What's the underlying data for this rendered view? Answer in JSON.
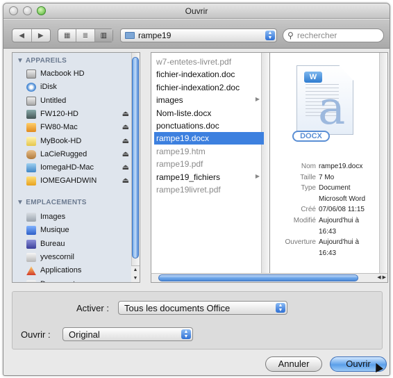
{
  "window": {
    "title": "Ouvrir"
  },
  "toolbar": {
    "back_label": "◀",
    "forward_label": "▶",
    "view_icon_label": "▦",
    "view_list_label": "≣",
    "view_column_label": "▥",
    "path": "rampe19",
    "search_placeholder": "rechercher"
  },
  "sidebar": {
    "section_devices": "▼ APPAREILS",
    "devices": [
      {
        "label": "Macbook HD",
        "icon": "hard-drive-icon",
        "eject": false
      },
      {
        "label": "iDisk",
        "icon": "idisk-icon",
        "eject": false
      },
      {
        "label": "Untitled",
        "icon": "hard-drive-icon",
        "eject": false
      },
      {
        "label": "FW120-HD",
        "icon": "external-drive-icon",
        "eject": true
      },
      {
        "label": "FW80-Mac",
        "icon": "external-drive-icon",
        "eject": true
      },
      {
        "label": "MyBook-HD",
        "icon": "external-drive-icon",
        "eject": true
      },
      {
        "label": "LaCieRugged",
        "icon": "external-drive-icon",
        "eject": true
      },
      {
        "label": "IomegaHD-Mac",
        "icon": "external-drive-icon",
        "eject": true
      },
      {
        "label": "IOMEGAHDWIN",
        "icon": "external-drive-icon",
        "eject": true
      }
    ],
    "eject_symbol": "⏏",
    "section_places": "▼ EMPLACEMENTS",
    "places": [
      {
        "label": "Images",
        "icon": "pictures-folder-icon"
      },
      {
        "label": "Musique",
        "icon": "music-folder-icon"
      },
      {
        "label": "Bureau",
        "icon": "desktop-folder-icon"
      },
      {
        "label": "yvescornil",
        "icon": "home-icon"
      },
      {
        "label": "Applications",
        "icon": "applications-icon"
      },
      {
        "label": "Documents",
        "icon": "documents-folder-icon"
      }
    ]
  },
  "files": [
    {
      "name": "w7-entetes-livret.pdf",
      "enabled": false,
      "folder": false,
      "selected": false
    },
    {
      "name": "fichier-indexation.doc",
      "enabled": true,
      "folder": false,
      "selected": false
    },
    {
      "name": "fichier-indexation2.doc",
      "enabled": true,
      "folder": false,
      "selected": false
    },
    {
      "name": "images",
      "enabled": true,
      "folder": true,
      "selected": false
    },
    {
      "name": "Nom-liste.docx",
      "enabled": true,
      "folder": false,
      "selected": false
    },
    {
      "name": "ponctuations.doc",
      "enabled": true,
      "folder": false,
      "selected": false
    },
    {
      "name": "rampe19.docx",
      "enabled": true,
      "folder": false,
      "selected": true
    },
    {
      "name": "rampe19.htm",
      "enabled": false,
      "folder": false,
      "selected": false
    },
    {
      "name": "rampe19.pdf",
      "enabled": false,
      "folder": false,
      "selected": false
    },
    {
      "name": "rampe19_fichiers",
      "enabled": true,
      "folder": true,
      "selected": false
    },
    {
      "name": "rampe19livret.pdf",
      "enabled": false,
      "folder": false,
      "selected": false
    }
  ],
  "folder_chevron": "▶",
  "preview": {
    "badge": "DOCX",
    "word_logo": "W",
    "info": [
      {
        "key": "Nom",
        "value": "rampe19.docx"
      },
      {
        "key": "Taille",
        "value": "7 Mo"
      },
      {
        "key": "Type",
        "value": "Document"
      },
      {
        "key": "",
        "value": "Microsoft Word"
      },
      {
        "key": "Créé",
        "value": "07/06/08 11:15"
      },
      {
        "key": "Modifié",
        "value": "Aujourd'hui à"
      },
      {
        "key": "",
        "value": "16:43"
      },
      {
        "key": "Ouverture",
        "value": "Aujourd'hui à"
      },
      {
        "key": "",
        "value": "16:43"
      }
    ]
  },
  "options": {
    "enable_label": "Activer :",
    "enable_value": "Tous les documents Office",
    "open_label": "Ouvrir :",
    "open_value": "Original"
  },
  "buttons": {
    "cancel": "Annuler",
    "open": "Ouvrir"
  },
  "colors": {
    "selection": "#3d80df",
    "accent_button": "#5b9fe9"
  }
}
